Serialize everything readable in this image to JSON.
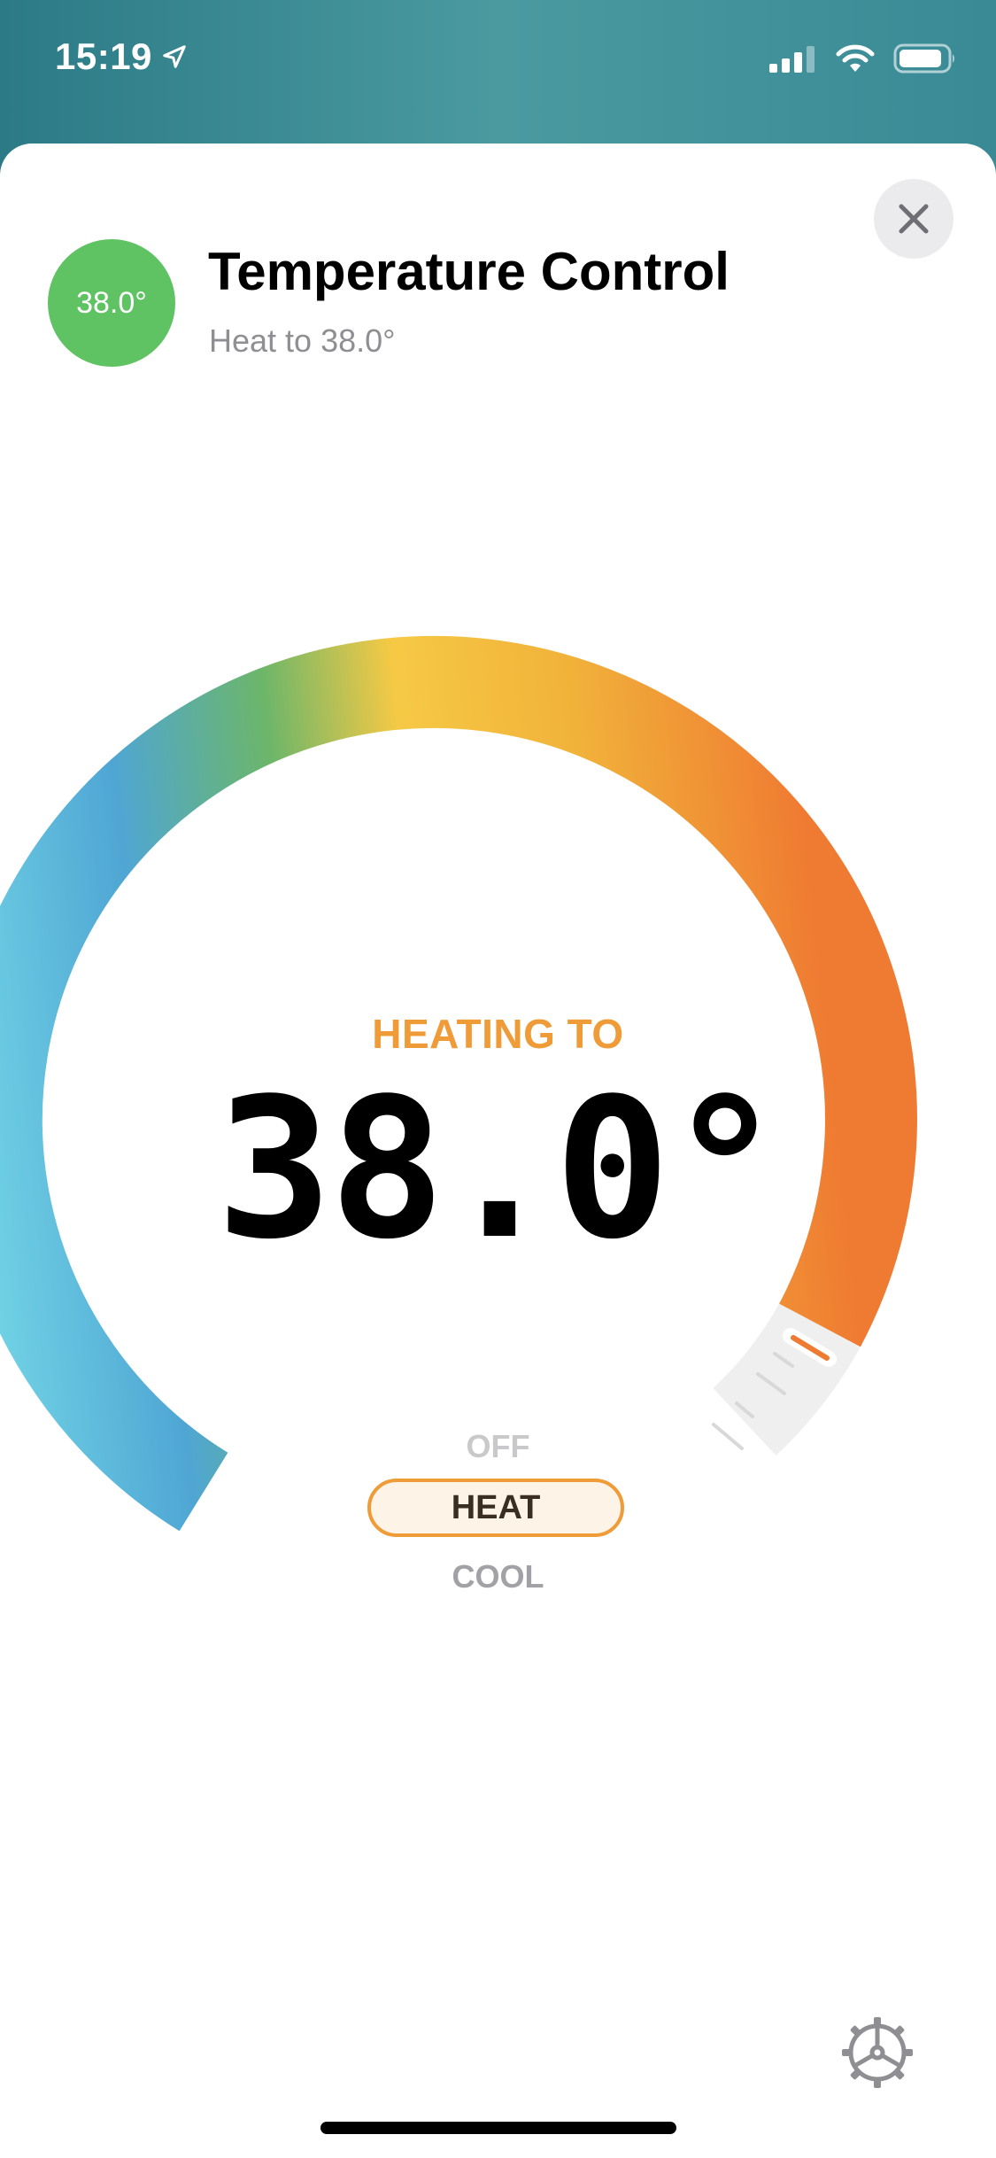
{
  "status_bar": {
    "time": "15:19",
    "location_icon": "location-arrow-icon",
    "signal_icon": "cellular-signal-icon",
    "wifi_icon": "wifi-icon",
    "battery_icon": "battery-icon"
  },
  "header": {
    "badge_value": "38.0°",
    "title": "Temperature Control",
    "subtitle": "Heat to 38.0°",
    "badge_color": "#5fc263"
  },
  "dial": {
    "status_label": "HEATING TO",
    "target_temperature": "38.0°",
    "status_color": "#ef9b37"
  },
  "modes": {
    "off_label": "OFF",
    "heat_label": "HEAT",
    "cool_label": "COOL",
    "selected": "HEAT"
  },
  "colors": {
    "header_background": "#3a8a96",
    "accent_orange": "#ef9b37",
    "dial_cold": "#74d6e6",
    "dial_warm": "#f6c945",
    "dial_hot": "#ef7a32"
  },
  "icons": {
    "close": "close-icon",
    "settings": "gear-icon"
  }
}
